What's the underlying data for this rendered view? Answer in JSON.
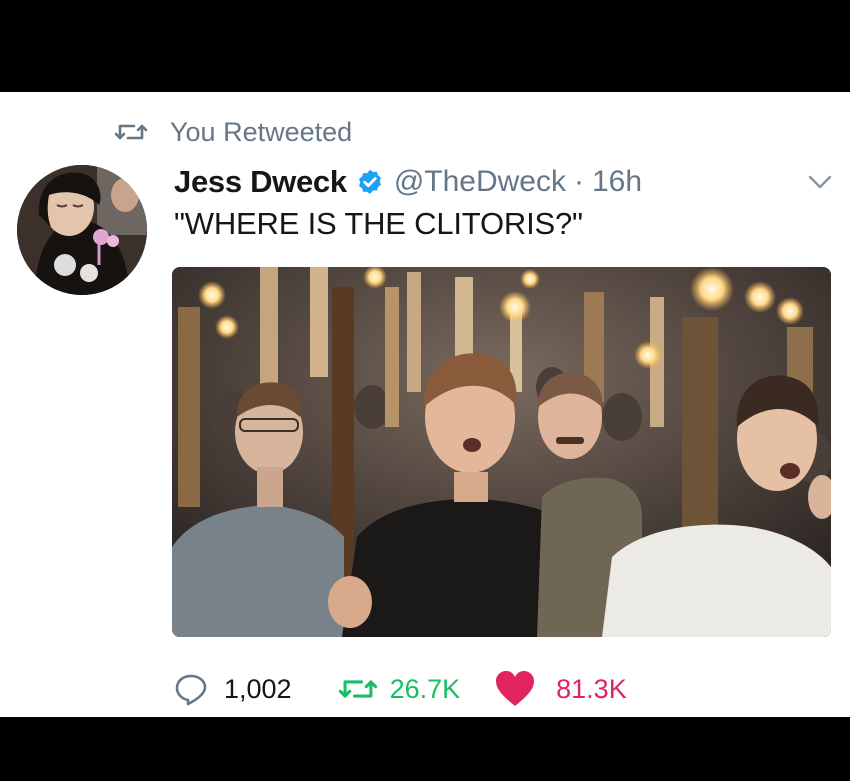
{
  "retweet_context": {
    "label": "You Retweeted",
    "icon": "retweet-icon"
  },
  "tweet": {
    "author_name": "Jess Dweck",
    "verified": true,
    "handle": "@TheDweck",
    "separator": "·",
    "time": "16h",
    "text": "\"WHERE IS THE CLITORIS?\"",
    "media": {
      "type": "photo"
    },
    "actions": {
      "replies": "1,002",
      "retweets": "26.7K",
      "likes": "81.3K"
    }
  },
  "colors": {
    "muted": "#657786",
    "verified_blue": "#1da1f2",
    "retweet_green": "#17bf63",
    "like_red": "#e0245e"
  }
}
